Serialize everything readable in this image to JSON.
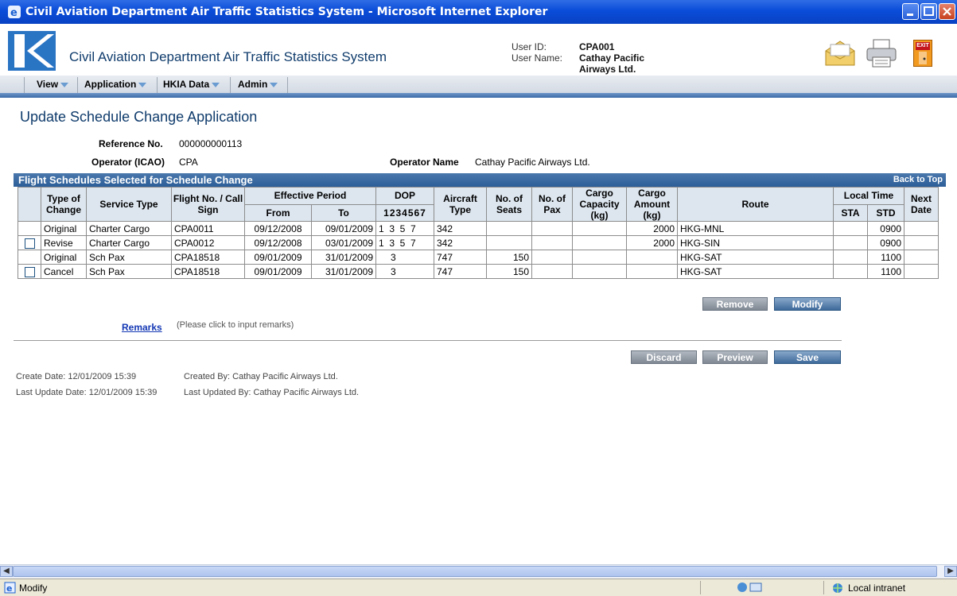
{
  "window": {
    "title": "Civil Aviation Department Air Traffic Statistics System - Microsoft Internet Explorer"
  },
  "header": {
    "app_title": "Civil Aviation Department Air Traffic Statistics System",
    "user_id_label": "User ID:",
    "user_id": "CPA001",
    "user_name_label": "User Name:",
    "user_name_line1": "Cathay Pacific",
    "user_name_line2": "Airways Ltd.",
    "exit_label": "EXIT"
  },
  "menu": [
    "View",
    "Application",
    "HKIA Data",
    "Admin"
  ],
  "page": {
    "title": "Update Schedule Change Application",
    "ref_label": "Reference No.",
    "ref_value": "000000000113",
    "operator_icao_label": "Operator (ICAO)",
    "operator_icao_value": "CPA",
    "operator_name_label": "Operator Name",
    "operator_name_value": "Cathay Pacific Airways Ltd."
  },
  "section": {
    "title": "Flight Schedules Selected for Schedule Change",
    "back_to_top": "Back to Top"
  },
  "table": {
    "headers": {
      "type_of_change": "Type of Change",
      "service_type": "Service Type",
      "flight_no": "Flight No. / Call Sign",
      "effective_period": "Effective Period",
      "from": "From",
      "to": "To",
      "dop": "DOP",
      "dop_days": "1234567",
      "aircraft_type": "Aircraft Type",
      "seats": "No. of Seats",
      "pax": "No. of Pax",
      "cargo_capacity": "Cargo Capacity (kg)",
      "cargo_amount": "Cargo Amount (kg)",
      "route": "Route",
      "local_time": "Local Time",
      "sta": "STA",
      "std": "STD",
      "next_date": "Next Date"
    },
    "rows": [
      {
        "checkbox": false,
        "type": "Original",
        "service": "Charter Cargo",
        "flight": "CPA0011",
        "from": "09/12/2008",
        "to": "09/01/2009",
        "dop": "1  3  5  7",
        "aircraft": "342",
        "seats": "",
        "pax": "",
        "cargo_cap": "",
        "cargo_amt": "2000",
        "route": "HKG-MNL",
        "sta": "",
        "std": "0900",
        "next": ""
      },
      {
        "checkbox": true,
        "type": "Revise",
        "service": "Charter Cargo",
        "flight": "CPA0012",
        "from": "09/12/2008",
        "to": "03/01/2009",
        "dop": "1  3  5  7",
        "aircraft": "342",
        "seats": "",
        "pax": "",
        "cargo_cap": "",
        "cargo_amt": "2000",
        "route": "HKG-SIN",
        "sta": "",
        "std": "0900",
        "next": ""
      },
      {
        "checkbox": false,
        "type": "Original",
        "service": "Sch Pax",
        "flight": "CPA18518",
        "from": "09/01/2009",
        "to": "31/01/2009",
        "dop": "3",
        "aircraft": "747",
        "seats": "150",
        "pax": "",
        "cargo_cap": "",
        "cargo_amt": "",
        "route": "HKG-SAT",
        "sta": "",
        "std": "1100",
        "next": ""
      },
      {
        "checkbox": true,
        "type": "Cancel",
        "service": "Sch Pax",
        "flight": "CPA18518",
        "from": "09/01/2009",
        "to": "31/01/2009",
        "dop": "3",
        "aircraft": "747",
        "seats": "150",
        "pax": "",
        "cargo_cap": "",
        "cargo_amt": "",
        "route": "HKG-SAT",
        "sta": "",
        "std": "1100",
        "next": ""
      }
    ]
  },
  "buttons": {
    "remove": "Remove",
    "modify": "Modify",
    "discard": "Discard",
    "preview": "Preview",
    "save": "Save"
  },
  "remarks": {
    "link": "Remarks",
    "hint": "(Please click to input remarks)"
  },
  "meta": {
    "create_date": "Create Date: 12/01/2009 15:39",
    "created_by": "Created By: Cathay Pacific Airways Ltd.",
    "last_update": "Last Update Date: 12/01/2009 15:39",
    "last_updated_by": "Last Updated By: Cathay Pacific Airways Ltd."
  },
  "statusbar": {
    "text": "Modify",
    "zone": "Local intranet"
  }
}
